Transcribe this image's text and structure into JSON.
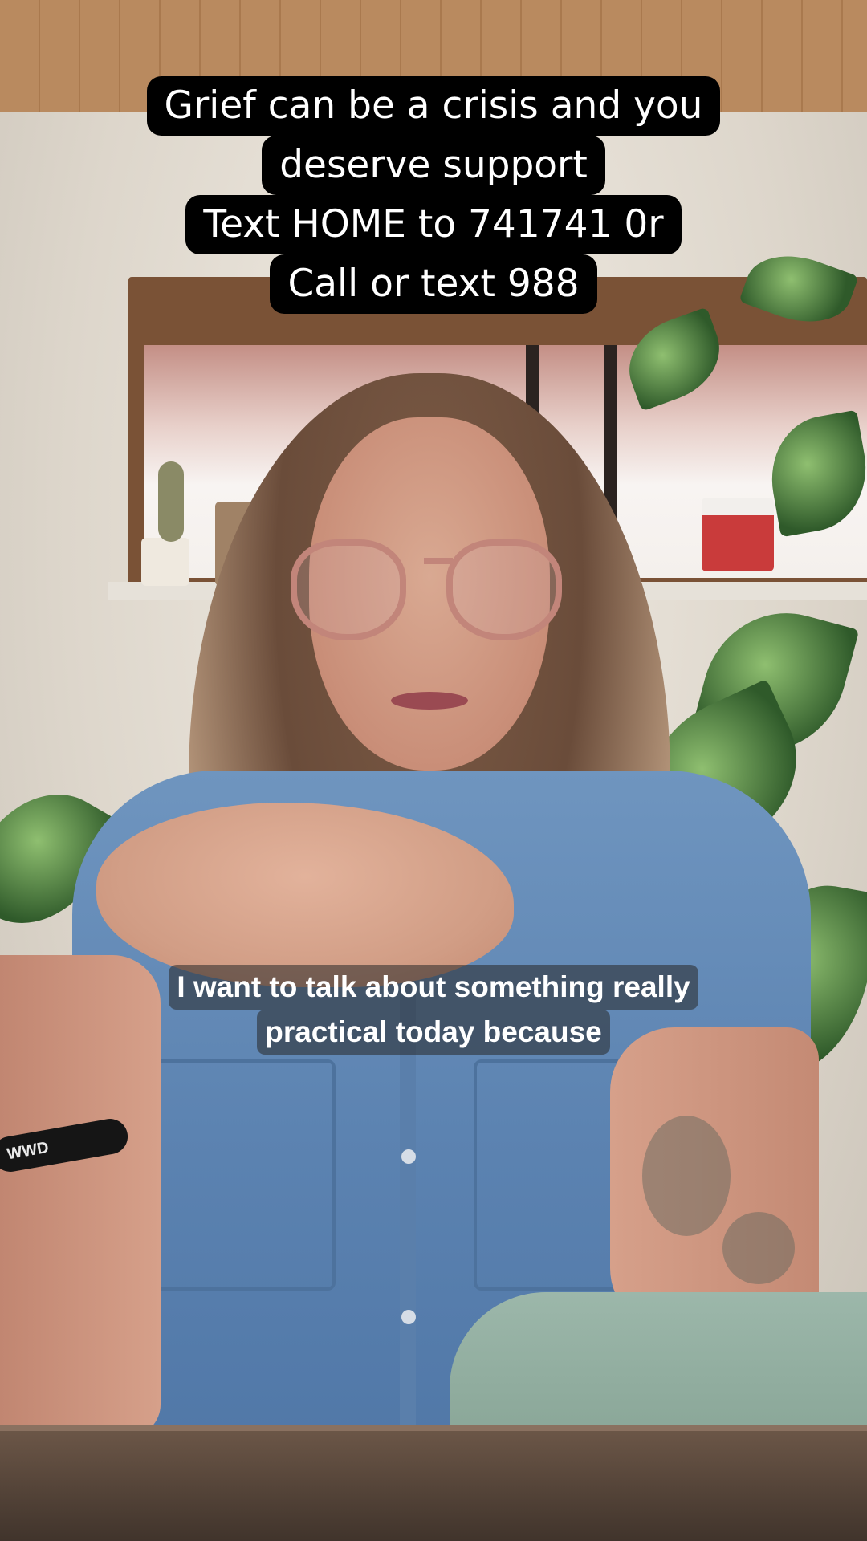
{
  "overlay_caption": {
    "lines": [
      "Grief can be a crisis and you",
      "deserve support",
      "Text HOME to 741741 0r",
      "Call or text 988"
    ]
  },
  "subtitle": {
    "lines": [
      "I want to talk about something really",
      "practical today because"
    ]
  },
  "wristband_text": "WWD",
  "colors": {
    "overlay_bg": "#000000",
    "overlay_text": "#ffffff",
    "subtitle_bg": "rgba(40,40,40,0.55)",
    "shirt": "#5c83b1"
  }
}
